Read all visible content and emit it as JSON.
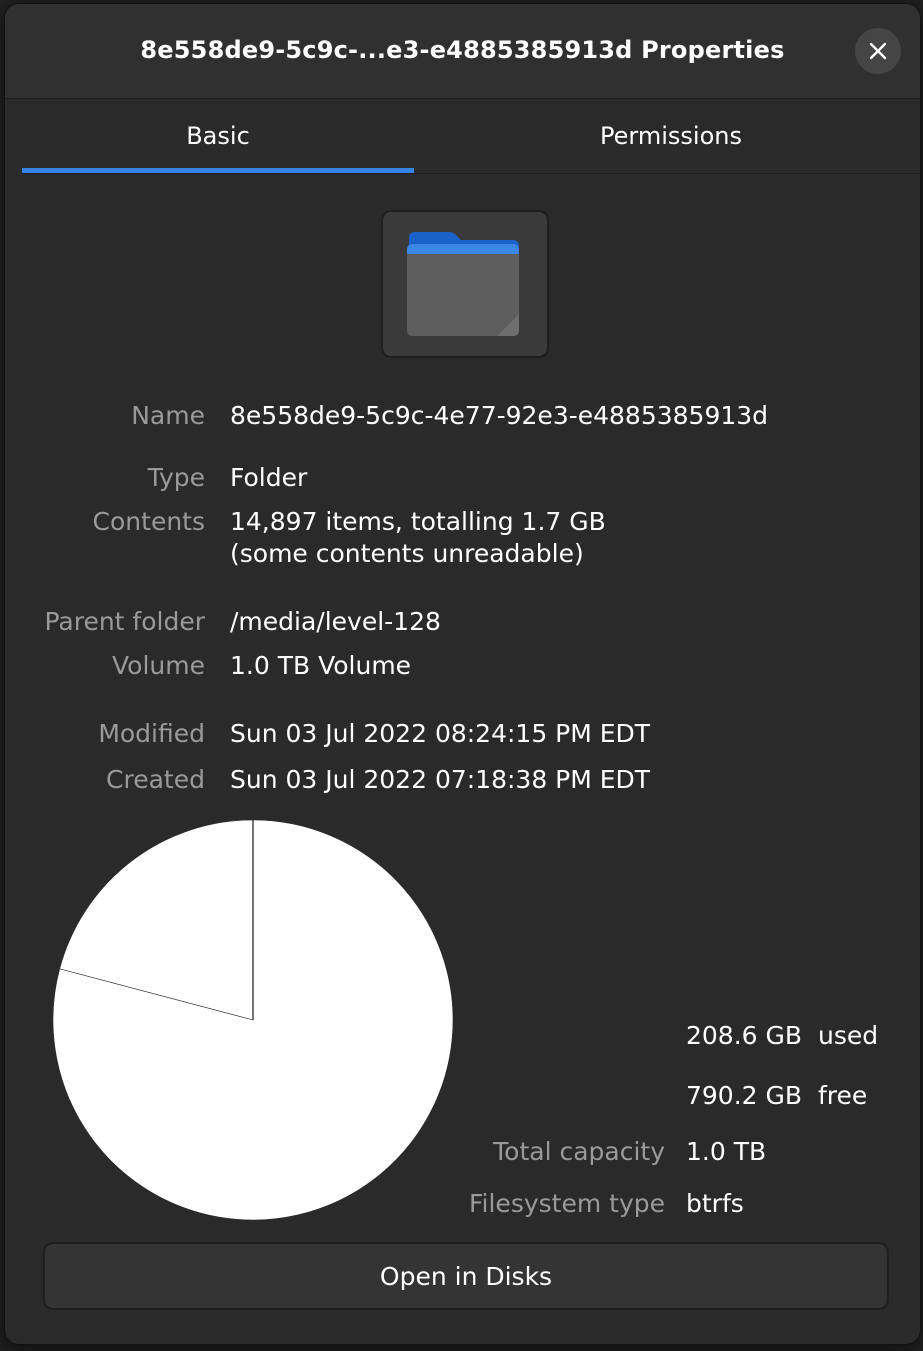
{
  "window": {
    "title": "8e558de9-5c9c-...e3-e4885385913d Properties",
    "close_icon": "close-icon"
  },
  "tabs": [
    {
      "label": "Basic",
      "active": true
    },
    {
      "label": "Permissions",
      "active": false
    }
  ],
  "folder_icon": "folder-icon",
  "colors": {
    "accent": "#3584e4",
    "folder_tab": "#1a62c9",
    "folder_body": "#5e5e5e",
    "pie_fill": "#ffffff"
  },
  "properties": {
    "name": {
      "label": "Name",
      "value": "8e558de9-5c9c-4e77-92e3-e4885385913d"
    },
    "type": {
      "label": "Type",
      "value": "Folder"
    },
    "contents": {
      "label": "Contents",
      "value": "14,897 items, totalling 1.7 GB",
      "note": "(some contents unreadable)"
    },
    "parent": {
      "label": "Parent folder",
      "value": "/media/level-128"
    },
    "volume": {
      "label": "Volume",
      "value": "1.0 TB Volume"
    },
    "modified": {
      "label": "Modified",
      "value": "Sun 03 Jul 2022 08:24:15 PM EDT"
    },
    "created": {
      "label": "Created",
      "value": "Sun 03 Jul 2022 07:18:38 PM EDT"
    }
  },
  "disk_usage": {
    "used_value": "208.6 GB",
    "used_label": "used",
    "free_value": "790.2 GB",
    "free_label": "free",
    "total_label": "Total capacity",
    "total_value": "1.0 TB",
    "fs_label": "Filesystem type",
    "fs_value": "btrfs",
    "used_gb": 208.6,
    "free_gb": 790.2
  },
  "actions": {
    "open_disks": "Open in Disks"
  }
}
